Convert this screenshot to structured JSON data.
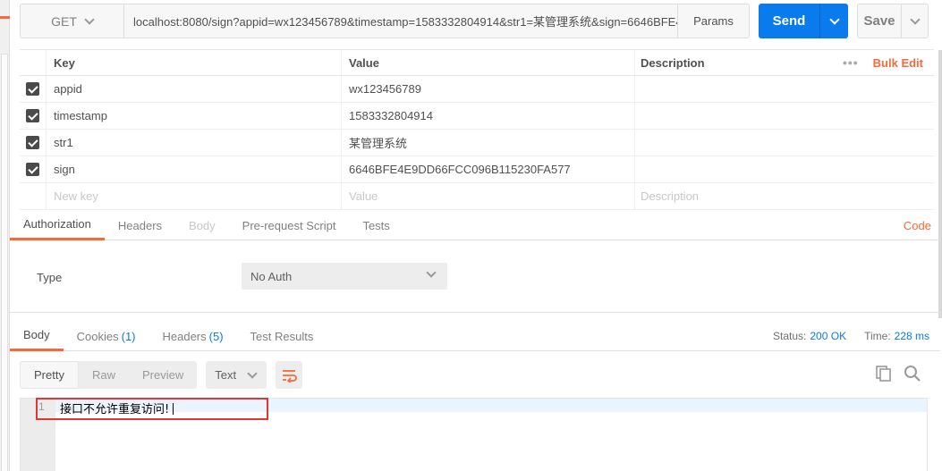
{
  "request": {
    "method": "GET",
    "url": "localhost:8080/sign?appid=wx123456789&timestamp=1583332804914&str1=某管理系统&sign=6646BFE4...",
    "params_label": "Params",
    "send_label": "Send",
    "save_label": "Save"
  },
  "params_table": {
    "headers": {
      "key": "Key",
      "value": "Value",
      "description": "Description"
    },
    "more": "•••",
    "bulk_edit": "Bulk Edit",
    "rows": [
      {
        "key": "appid",
        "value": "wx123456789",
        "checked": true
      },
      {
        "key": "timestamp",
        "value": "1583332804914",
        "checked": true
      },
      {
        "key": "str1",
        "value": "某管理系统",
        "checked": true
      },
      {
        "key": "sign",
        "value": "6646BFE4E9DD66FCC096B115230FA577",
        "checked": true
      }
    ],
    "new_row": {
      "key": "New key",
      "value": "Value",
      "description": "Description"
    }
  },
  "request_tabs": {
    "authorization": "Authorization",
    "headers": "Headers",
    "body": "Body",
    "prerequest": "Pre-request Script",
    "tests": "Tests",
    "code": "Code"
  },
  "auth": {
    "type_label": "Type",
    "type_value": "No Auth"
  },
  "response_tabs": {
    "body": "Body",
    "cookies": "Cookies",
    "cookies_count": "(1)",
    "headers": "Headers",
    "headers_count": "(5)",
    "test_results": "Test Results"
  },
  "status": {
    "status_label": "Status:",
    "status_value": "200 OK",
    "time_label": "Time:",
    "time_value": "228 ms"
  },
  "body_toolbar": {
    "pretty": "Pretty",
    "raw": "Raw",
    "preview": "Preview",
    "format": "Text"
  },
  "response_body": {
    "line_number": "1",
    "text": "接口不允许重复访问!"
  },
  "colors": {
    "accent": "#f26b3a",
    "send": "#097bed",
    "highlight_box": "#e33535"
  }
}
